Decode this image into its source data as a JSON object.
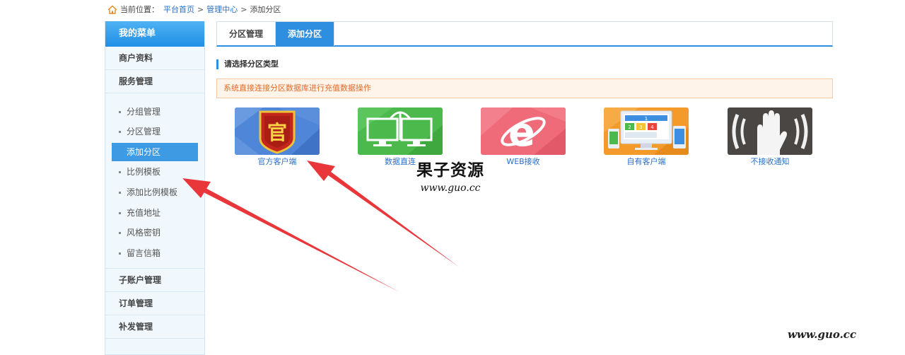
{
  "breadcrumb": {
    "prefix": "当前位置：",
    "home": "平台首页",
    "sep1": ">",
    "mid": "管理中心",
    "sep2": ">",
    "current": "添加分区"
  },
  "sidebar": {
    "header": "我的菜单",
    "groups_top": [
      {
        "label": "商户资料"
      },
      {
        "label": "服务管理"
      }
    ],
    "sub_items": [
      {
        "label": "分组管理",
        "active": false
      },
      {
        "label": "分区管理",
        "active": false
      },
      {
        "label": "添加分区",
        "active": true
      },
      {
        "label": "比例模板",
        "active": false
      },
      {
        "label": "添加比例模板",
        "active": false
      },
      {
        "label": "充值地址",
        "active": false
      },
      {
        "label": "风格密钥",
        "active": false
      },
      {
        "label": "留言信箱",
        "active": false
      }
    ],
    "groups_bottom": [
      {
        "label": "子账户管理"
      },
      {
        "label": "订单管理"
      },
      {
        "label": "补发管理"
      }
    ]
  },
  "tabs": [
    {
      "label": "分区管理",
      "active": false
    },
    {
      "label": "添加分区",
      "active": true
    }
  ],
  "section_title": "请选择分区类型",
  "notice": "系统直接连接分区数据库进行充值数据操作",
  "types": [
    {
      "label": "官方客户端",
      "icon": "official-badge-icon",
      "color": "#4f86d8",
      "glyph": "官"
    },
    {
      "label": "数据直连",
      "icon": "monitors-icon",
      "color": "#4cb94c"
    },
    {
      "label": "WEB接收",
      "icon": "ie-browser-icon",
      "color": "#ef6b7a",
      "glyph": "e"
    },
    {
      "label": "自有客户端",
      "icon": "devices-icon",
      "color": "#f39a2a",
      "digits": [
        "1",
        "2",
        "3",
        "4"
      ]
    },
    {
      "label": "不接收通知",
      "icon": "hand-stop-icon",
      "color": "#4a4643"
    }
  ],
  "watermark": {
    "title": "果子资源",
    "url": "www.guo.cc",
    "corner": "www.guo.cc"
  },
  "colors": {
    "accent": "#2e8ee0",
    "link": "#2a6fc7",
    "notice_text": "#e26a28",
    "arrow": "#e8363a"
  }
}
